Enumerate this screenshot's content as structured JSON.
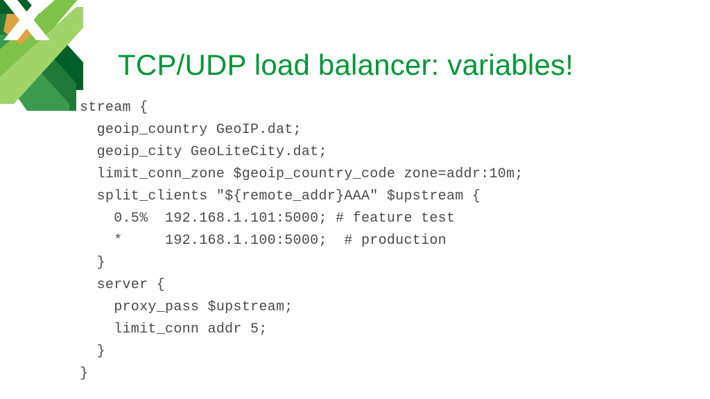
{
  "title": "TCP/UDP load balancer: variables!",
  "code": "stream {\n  geoip_country GeoIP.dat;\n  geoip_city GeoLiteCity.dat;\n  limit_conn_zone $geoip_country_code zone=addr:10m;\n  split_clients \"${remote_addr}AAA\" $upstream {\n    0.5%  192.168.1.101:5000; # feature test\n    *     192.168.1.100:5000;  # production\n  }\n  server {\n    proxy_pass $upstream;\n    limit_conn addr 5;\n  }\n}"
}
